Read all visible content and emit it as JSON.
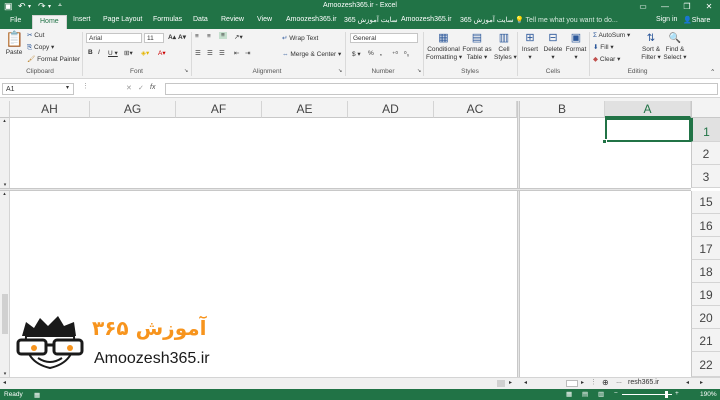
{
  "window": {
    "title": "Amoozesh365.ir - Excel"
  },
  "ribbon_tabs": [
    "File",
    "Home",
    "Insert",
    "Page Layout",
    "Formulas",
    "Data",
    "Review",
    "View",
    "Amoozesh365.ir",
    "365 سایت آموزش",
    "Amoozesh365.ir",
    "365 سایت آموزش"
  ],
  "tell_me": "Tell me what you want to do...",
  "account": {
    "signin": "Sign in",
    "share": "Share"
  },
  "clipboard": {
    "paste": "Paste",
    "cut": "Cut",
    "copy": "Copy",
    "format_painter": "Format Painter",
    "group": "Clipboard"
  },
  "font": {
    "name": "Arial",
    "size": "11",
    "group": "Font"
  },
  "alignment": {
    "wrap": "Wrap Text",
    "merge": "Merge & Center",
    "group": "Alignment"
  },
  "number": {
    "format": "General",
    "currency": "$",
    "percent": "%",
    "comma": ",",
    "group": "Number"
  },
  "styles": {
    "cond": "Conditional",
    "cond2": "Formatting",
    "table": "Format as",
    "table2": "Table",
    "cell": "Cell",
    "cell2": "Styles",
    "group": "Styles"
  },
  "cells": {
    "insert": "Insert",
    "delete": "Delete",
    "format": "Format",
    "group": "Cells"
  },
  "editing": {
    "autosum": "AutoSum",
    "fill": "Fill",
    "clear": "Clear",
    "sort": "Sort &",
    "sort2": "Filter",
    "find": "Find &",
    "find2": "Select",
    "group": "Editing"
  },
  "namebox": "A1",
  "fx": "fx",
  "columns_left": [
    "AH",
    "AG",
    "AF",
    "AE",
    "AD",
    "AC"
  ],
  "columns_right": [
    "B",
    "A"
  ],
  "rows_top": [
    "1",
    "2",
    "3"
  ],
  "rows_bottom": [
    "15",
    "16",
    "17",
    "18",
    "19",
    "20",
    "21",
    "22"
  ],
  "logo": {
    "persian": "آموزش ۳۶۵",
    "text": "Amoozesh365.ir"
  },
  "sheet_tab": "resh365.ir",
  "status": {
    "ready": "Ready",
    "zoom": "190%"
  },
  "colors": {
    "accent": "#217346",
    "selected": "#217346",
    "logo_orange": "#f7941d"
  }
}
